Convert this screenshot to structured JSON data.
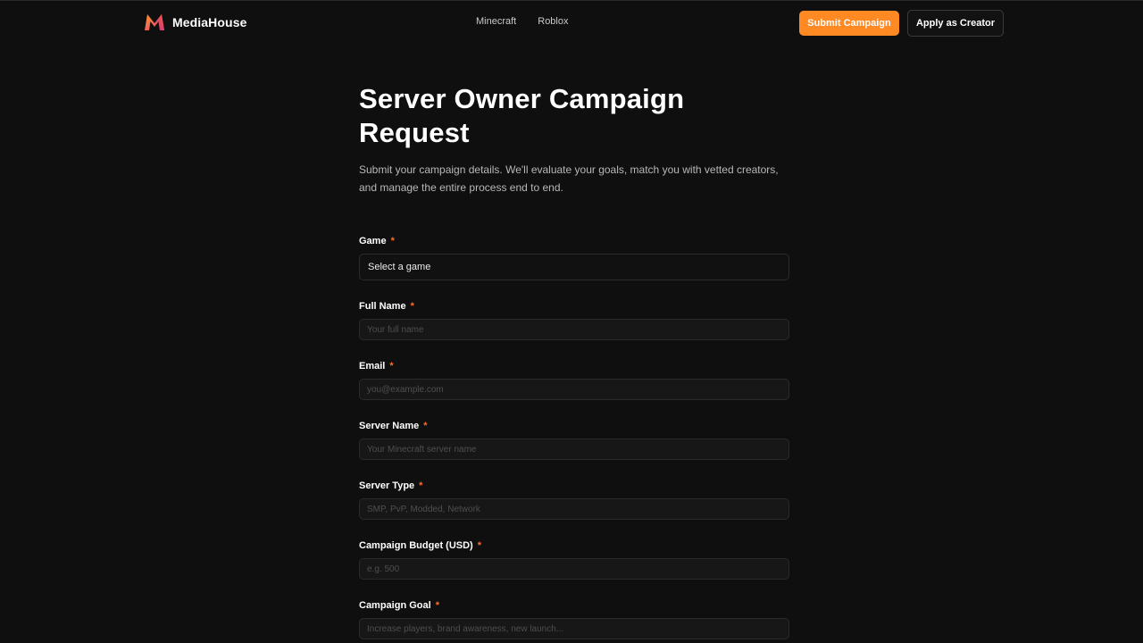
{
  "brand": {
    "name": "MediaHouse",
    "logo_icon": "mediahouse-logo-icon",
    "accent": "#ff8a24"
  },
  "nav": {
    "items": [
      "Minecraft",
      "Roblox"
    ]
  },
  "header": {
    "submit_campaign": "Submit Campaign",
    "apply_creator": "Apply as Creator"
  },
  "main": {
    "title": "Server Owner Campaign Request",
    "subtitle": "Submit your campaign details. We'll evaluate your goals, match you with vetted creators, and manage the entire process end to end."
  },
  "form": {
    "required_marker": "*",
    "game": {
      "label": "Game",
      "value": "Select a game"
    },
    "full_name": {
      "label": "Full Name",
      "placeholder": "Your full name"
    },
    "email": {
      "label": "Email",
      "placeholder": "you@example.com"
    },
    "server_name": {
      "label": "Server Name",
      "placeholder": "Your Minecraft server name"
    },
    "server_type": {
      "label": "Server Type",
      "placeholder": "SMP, PvP, Modded, Network"
    },
    "budget": {
      "label": "Campaign Budget (USD)",
      "placeholder": "e.g. 500"
    },
    "goal": {
      "label": "Campaign Goal",
      "placeholder": "Increase players, brand awareness, new launch..."
    }
  }
}
